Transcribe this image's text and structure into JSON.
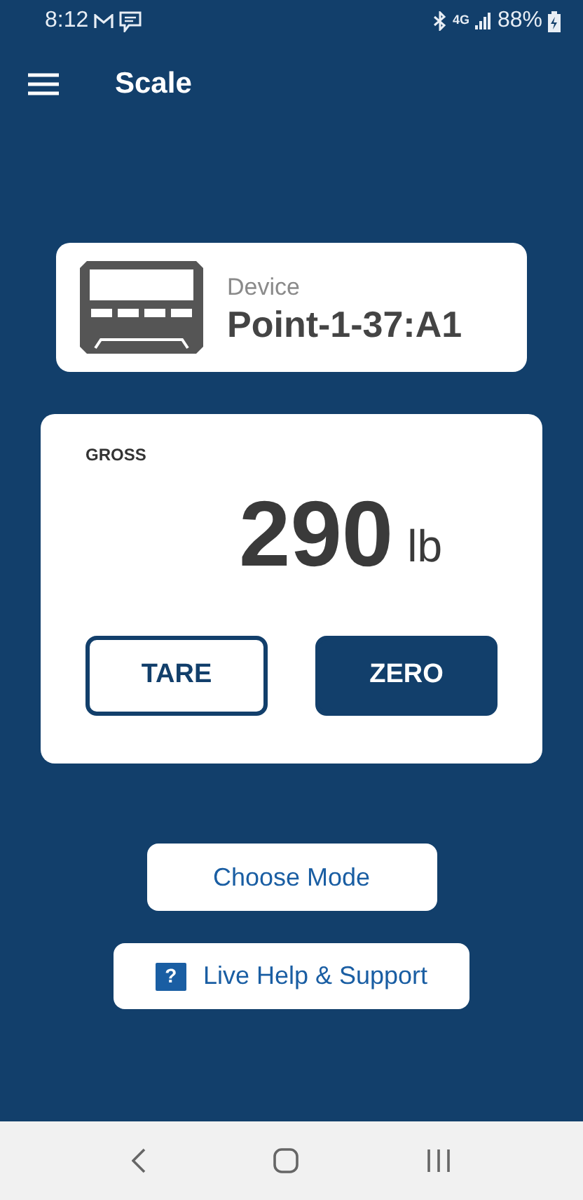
{
  "status_bar": {
    "time": "8:12",
    "network": "4G",
    "battery": "88%"
  },
  "app_bar": {
    "title": "Scale"
  },
  "device": {
    "label": "Device",
    "name": "Point-1-37:A1"
  },
  "reading": {
    "mode": "GROSS",
    "value": "290",
    "unit": "lb"
  },
  "scale_buttons": [
    {
      "label": "TARE",
      "kind": "outline"
    },
    {
      "label": "ZERO",
      "kind": "filled"
    }
  ],
  "actions": [
    {
      "label": "Choose Mode",
      "kind": "plain"
    },
    {
      "label": "Live Help & Support",
      "kind": "help",
      "icon_glyph": "?"
    }
  ]
}
